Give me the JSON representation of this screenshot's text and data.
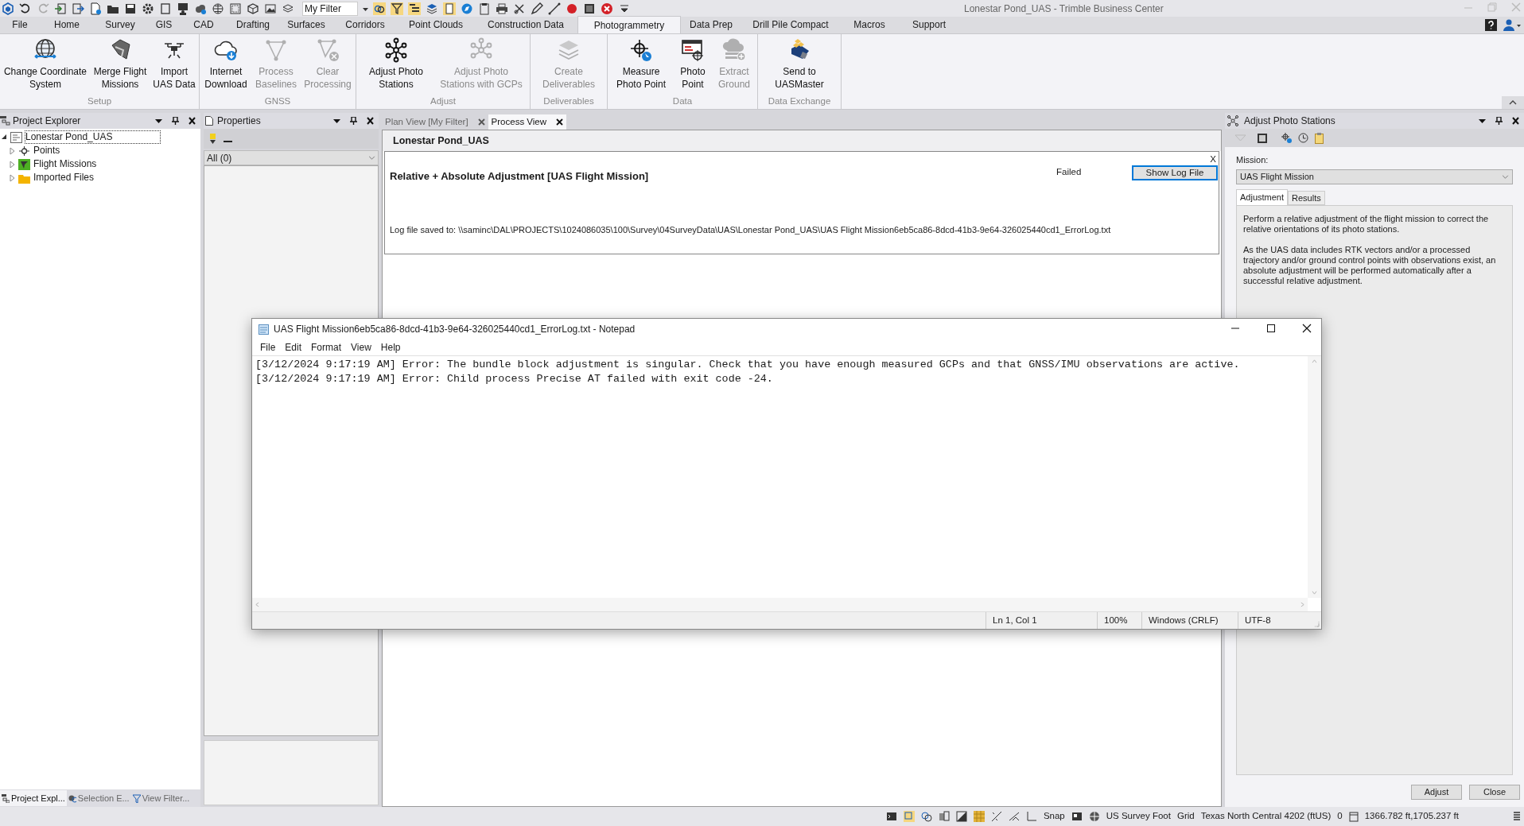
{
  "title_bar": {
    "title": "Lonestar Pond_UAS - Trimble Business Center",
    "filter": "My Filter"
  },
  "menu_tabs": [
    {
      "label": "File",
      "selected": false
    },
    {
      "label": "Home",
      "selected": false
    },
    {
      "label": "Survey",
      "selected": false
    },
    {
      "label": "GIS",
      "selected": false
    },
    {
      "label": "CAD",
      "selected": false
    },
    {
      "label": "Drafting",
      "selected": false
    },
    {
      "label": "Surfaces",
      "selected": false
    },
    {
      "label": "Corridors",
      "selected": false
    },
    {
      "label": "Point Clouds",
      "selected": false
    },
    {
      "label": "Construction Data",
      "selected": false
    },
    {
      "label": "Photogrammetry",
      "selected": true
    },
    {
      "label": "Data Prep",
      "selected": false
    },
    {
      "label": "Drill Pile Compact",
      "selected": false
    },
    {
      "label": "Macros",
      "selected": false
    },
    {
      "label": "Support",
      "selected": false
    }
  ],
  "ribbon": [
    {
      "label": "Setup",
      "buttons": [
        {
          "label": "Change Coordinate\nSystem",
          "disabled": false
        },
        {
          "label": "Merge Flight\nMissions",
          "disabled": false
        },
        {
          "label": "Import\nUAS Data",
          "disabled": false
        }
      ]
    },
    {
      "label": "GNSS",
      "buttons": [
        {
          "label": "Internet\nDownload",
          "disabled": false
        },
        {
          "label": "Process\nBaselines",
          "disabled": true
        },
        {
          "label": "Clear\nProcessing",
          "disabled": true
        }
      ]
    },
    {
      "label": "Adjust",
      "buttons": [
        {
          "label": "Adjust Photo\nStations",
          "disabled": false
        },
        {
          "label": "Adjust Photo\nStations with GCPs",
          "disabled": true
        }
      ]
    },
    {
      "label": "Deliverables",
      "buttons": [
        {
          "label": "Create\nDeliverables",
          "disabled": true
        }
      ]
    },
    {
      "label": "Data",
      "buttons": [
        {
          "label": "Measure\nPhoto Point",
          "disabled": false
        },
        {
          "label": "Photo\nPoint",
          "disabled": false
        },
        {
          "label": "Extract\nGround",
          "disabled": true
        }
      ]
    },
    {
      "label": "Data Exchange",
      "buttons": [
        {
          "label": "Send to\nUASMaster",
          "disabled": false
        }
      ]
    }
  ],
  "project_explorer": {
    "title": "Project Explorer",
    "tree": [
      {
        "label": "Lonestar Pond_UAS",
        "expanded": true,
        "children": [
          {
            "label": "Points",
            "expanded": false
          },
          {
            "label": "Flight Missions",
            "expanded": false
          },
          {
            "label": "Imported Files",
            "expanded": false
          }
        ]
      }
    ]
  },
  "properties": {
    "title": "Properties",
    "filter": "All (0)"
  },
  "bottom_tabs": [
    {
      "label": "Project Expl...",
      "selected": true
    },
    {
      "label": "Selection E...",
      "selected": false
    },
    {
      "label": "View Filter...",
      "selected": false
    }
  ],
  "document_tabs": [
    {
      "label": "Plan View [My Filter]",
      "selected": false
    },
    {
      "label": "Process View",
      "selected": true
    }
  ],
  "process_view": {
    "project": "Lonestar Pond_UAS",
    "task": "Relative + Absolute Adjustment [UAS Flight Mission]",
    "status": "Failed",
    "button": "Show Log File",
    "close": "X",
    "log": "Log file saved to: \\\\saminc\\DAL\\PROJECTS\\1024086035\\100\\Survey\\04SurveyData\\UAS\\Lonestar Pond_UAS\\UAS Flight Mission6eb5ca86-8dcd-41b3-9e64-326025440cd1_ErrorLog.txt"
  },
  "adjust_panel": {
    "title": "Adjust Photo Stations",
    "mission_label": "Mission:",
    "mission": "UAS Flight Mission",
    "tabs": [
      {
        "label": "Adjustment",
        "selected": true
      },
      {
        "label": "Results",
        "selected": false
      }
    ],
    "paragraphs": [
      "Perform a relative adjustment of the flight mission to correct the relative orientations of its photo stations.",
      "As the UAS data includes RTK vectors and/or a processed trajectory and/or ground control points with observations exist, an absolute adjustment will be performed automatically after a successful relative adjustment."
    ],
    "buttons": [
      "Adjust",
      "Close"
    ]
  },
  "notepad": {
    "title": "UAS Flight Mission6eb5ca86-8dcd-41b3-9e64-326025440cd1_ErrorLog.txt - Notepad",
    "menu": [
      "File",
      "Edit",
      "Format",
      "View",
      "Help"
    ],
    "lines": [
      "[3/12/2024 9:17:19 AM] Error: The bundle block adjustment is singular. Check that you have enough measured GCPs and that GNSS/IMU observations are active.",
      "[3/12/2024 9:17:19 AM] Error: Child process Precise AT failed with exit code -24."
    ],
    "status": [
      "Ln 1, Col 1",
      "100%",
      "Windows (CRLF)",
      "UTF-8"
    ]
  },
  "status_bar": [
    "Snap",
    "US Survey Foot",
    "Grid",
    "Texas North Central 4202 (ftUS)",
    "0",
    "1366.782 ft,1705.237 ft"
  ]
}
